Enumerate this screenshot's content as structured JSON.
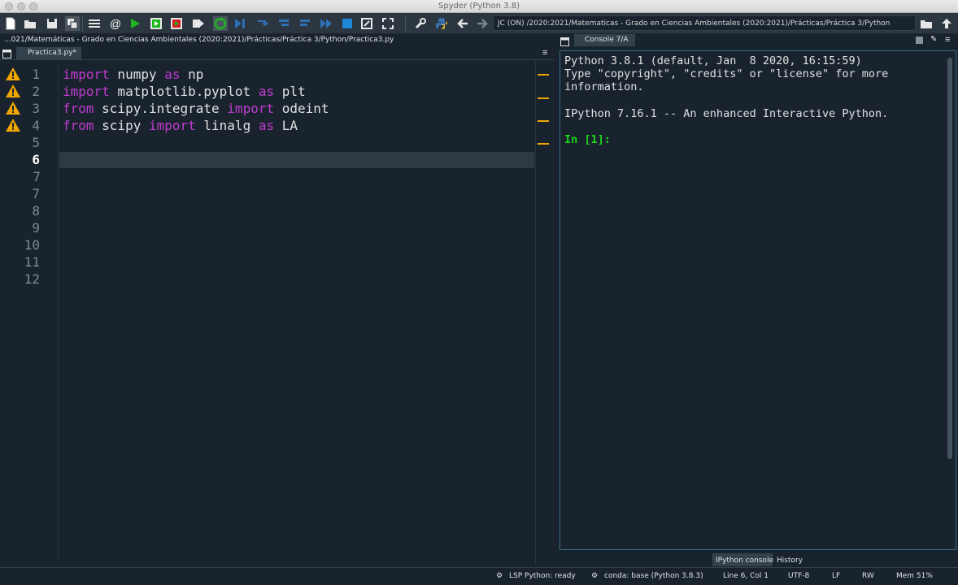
{
  "window": {
    "title": "Spyder (Python 3.8)"
  },
  "toolbar": {
    "working_dir": "JC (ON) /2020:2021/Matematicas - Grado en Ciencias Ambientales (2020:2021)/Prácticas/Práctica 3/Python",
    "icons": [
      "new-file",
      "open-file",
      "save",
      "save-all",
      "outline",
      "at",
      "run",
      "run-cell",
      "run-cell-advance",
      "run-selection",
      "re-run",
      "debug",
      "step",
      "step-into",
      "step-return",
      "continue",
      "stop",
      "maximize",
      "fullscreen",
      "preferences",
      "python-path",
      "back",
      "forward",
      "browse",
      "parent-dir"
    ],
    "accent_colors": {
      "run": "#1eb71e",
      "stop": "#1f88d8",
      "debug": "#2f6fb5",
      "warning": "#f0a500"
    }
  },
  "editor": {
    "path": "...021/Matemáticas - Grado en Ciencias Ambientales (2020:2021)/Prácticas/Práctica 3/Python/Practica3.py",
    "tab_label": "Practica3.py*",
    "line_numbers": [
      "1",
      "2",
      "3",
      "4",
      "5",
      "6",
      "7",
      "8",
      "9",
      "10",
      "11",
      "12"
    ],
    "current_line": "6",
    "lines": [
      {
        "kw1": "import",
        "t1": " numpy ",
        "kw2": "as",
        "t2": " np"
      },
      {
        "kw1": "import",
        "t1": " matplotlib.pyplot ",
        "kw2": "as",
        "t2": " plt"
      },
      {
        "kw1": "from",
        "t1": " scipy.integrate ",
        "kw2": "import",
        "t2": " odeint"
      },
      {
        "kw1": "from",
        "t1": " scipy ",
        "kw2": "import",
        "t2": " linalg ",
        "kw3": "as",
        "t3": " LA"
      }
    ]
  },
  "console": {
    "tab_label": "Console 7/A",
    "banner_line1": "Python 3.8.1 (default, Jan  8 2020, 16:15:59)",
    "banner_line2": "Type \"copyright\", \"credits\" or \"license\" for more",
    "banner_line3": "information.",
    "banner_line4": "IPython 7.16.1 -- An enhanced Interactive Python.",
    "prompt": "In [1]:",
    "bottom_tabs": [
      "IPython console",
      "History"
    ]
  },
  "statusbar": {
    "lsp": "LSP Python: ready",
    "conda": "conda: base (Python 3.8.3)",
    "position": "Line 6, Col 1",
    "encoding": "UTF-8",
    "eol": "LF",
    "permissions": "RW",
    "memory": "Mem 51%"
  }
}
